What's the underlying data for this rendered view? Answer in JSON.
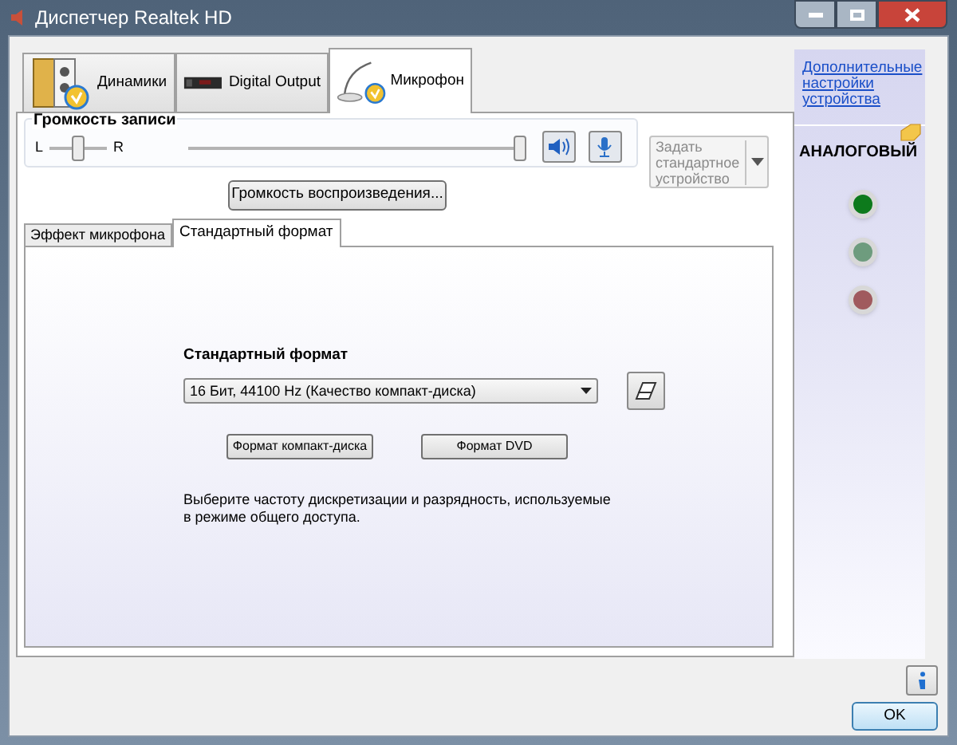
{
  "window": {
    "title": "Диспетчер Realtek HD"
  },
  "device_tabs": [
    {
      "label": "Динамики",
      "kind": "speakers",
      "selected": false
    },
    {
      "label": "Digital Output",
      "kind": "digital",
      "selected": false
    },
    {
      "label": "Микрофон",
      "kind": "mic",
      "selected": true
    }
  ],
  "recording_volume": {
    "label": "Громкость записи",
    "left": "L",
    "right": "R",
    "balance": {
      "level": 0.5
    },
    "volume": {
      "level": 1.0
    }
  },
  "default_device_button": {
    "label": "Задать стандартное устройство"
  },
  "playback_volume_button": "Громкость воспроизведения...",
  "sub_tabs": [
    {
      "label": "Эффект микрофона",
      "selected": false
    },
    {
      "label": "Стандартный формат",
      "selected": true
    }
  ],
  "format": {
    "heading": "Стандартный формат",
    "dropdown_value": "16 Бит, 44100 Hz (Качество компакт-диска)",
    "buttons": [
      "Формат компакт-диска",
      "Формат DVD"
    ],
    "description": "Выберите частоту дискретизации и разрядность, используемые в режиме общего доступа."
  },
  "side_panel": {
    "link": "Дополнительные настройки устройства",
    "heading": "АНАЛОГОВЫЙ",
    "jacks": [
      {
        "color": "#0d7a1c"
      },
      {
        "color": "#6e9c7e"
      },
      {
        "color": "#a05a5e"
      }
    ]
  },
  "ok_button": "OK"
}
